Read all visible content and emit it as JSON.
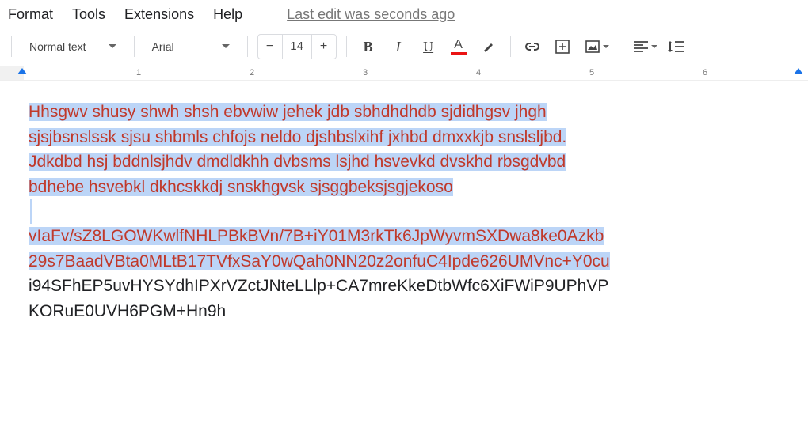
{
  "menubar": {
    "format": "Format",
    "tools": "Tools",
    "extensions": "Extensions",
    "help": "Help",
    "last_edit": "Last edit was seconds ago"
  },
  "toolbar": {
    "style_label": "Normal text",
    "font_label": "Arial",
    "font_size": "14"
  },
  "ruler": {
    "n1": "1",
    "n2": "2",
    "n3": "3",
    "n4": "4",
    "n5": "5",
    "n6": "6"
  },
  "doc": {
    "p1_l1": "Hhsgwv shusy shwh shsh ebvwiw jehek jdb sbhdhdhdb sjdidhgsv jhgh",
    "p1_l2": "sjsjbsnslssk sjsu shbmls chfojs neldo djshbslxihf jxhbd dmxxkjb snslsljbd.",
    "p1_l3": "Jdkdbd hsj bddnlsjhdv dmdldkhh dvbsms lsjhd hsvevkd dvskhd rbsgdvbd",
    "p1_l4": "bdhebe hsvebkl dkhcskkdj snskhgvsk sjsggbeksjsgjekoso",
    "p2_l1": "vIaFv/sZ8LGOWKwlfNHLPBkBVn/7B+iY01M3rkTk6JpWyvmSXDwa8ke0Azkb",
    "p2_l2": "29s7BaadVBta0MLtB17TVfxSaY0wQah0NN20z2onfuC4Ipde626UMVnc+Y0cu",
    "p3_l1": "i94SFhEP5uvHYSYdhIPXrVZctJNteLLlp+CA7mreKkeDtbWfc6XiFWiP9UPhVP",
    "p3_l2": "KORuE0UVH6PGM+Hn9h"
  }
}
